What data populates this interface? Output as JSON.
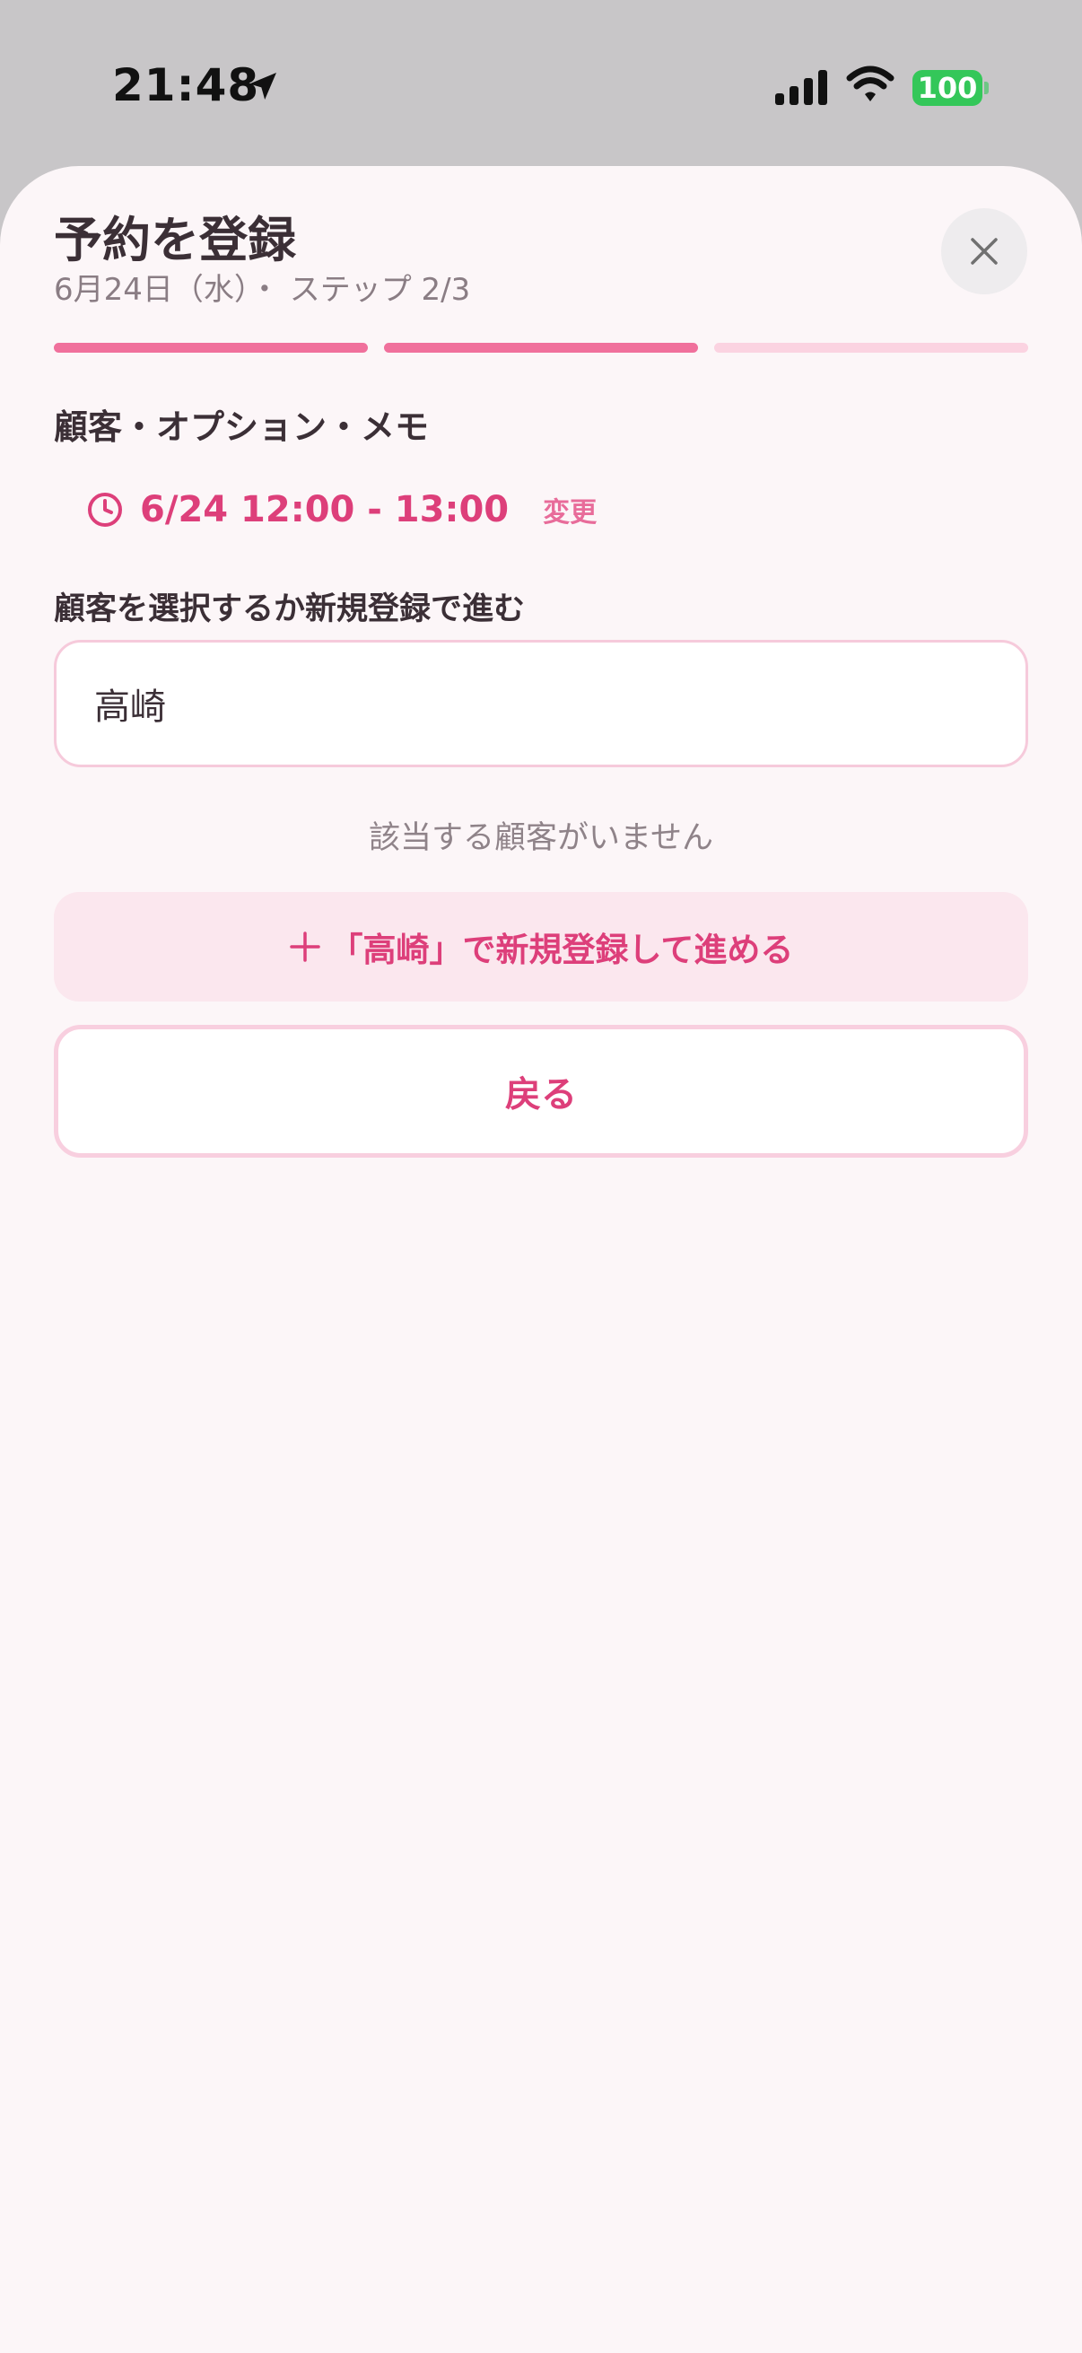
{
  "status_bar": {
    "time": "21:48",
    "battery": "100"
  },
  "header": {
    "title": "予約を登録",
    "subtitle": "6月24日（水）・ ステップ 2/3",
    "close_icon": "close-icon"
  },
  "progress": {
    "current_step": 2,
    "total_steps": 3,
    "active_color": "#f0709c",
    "inactive_color": "#fbd3e1"
  },
  "section": {
    "title": "顧客・オプション・メモ"
  },
  "schedule": {
    "icon": "clock-icon",
    "time_text": "6/24 12:00 - 13:00",
    "change_label": "変更"
  },
  "customer": {
    "label": "顧客を選択するか新規登録で進む",
    "search_value": "高崎",
    "no_results": "該当する顧客がいません",
    "register_label": "「高崎」で新規登録して進める",
    "register_icon": "plus-icon"
  },
  "actions": {
    "back_label": "戻る"
  },
  "colors": {
    "accent": "#dd3f7a",
    "sheet_background": "#fcf6f8"
  }
}
